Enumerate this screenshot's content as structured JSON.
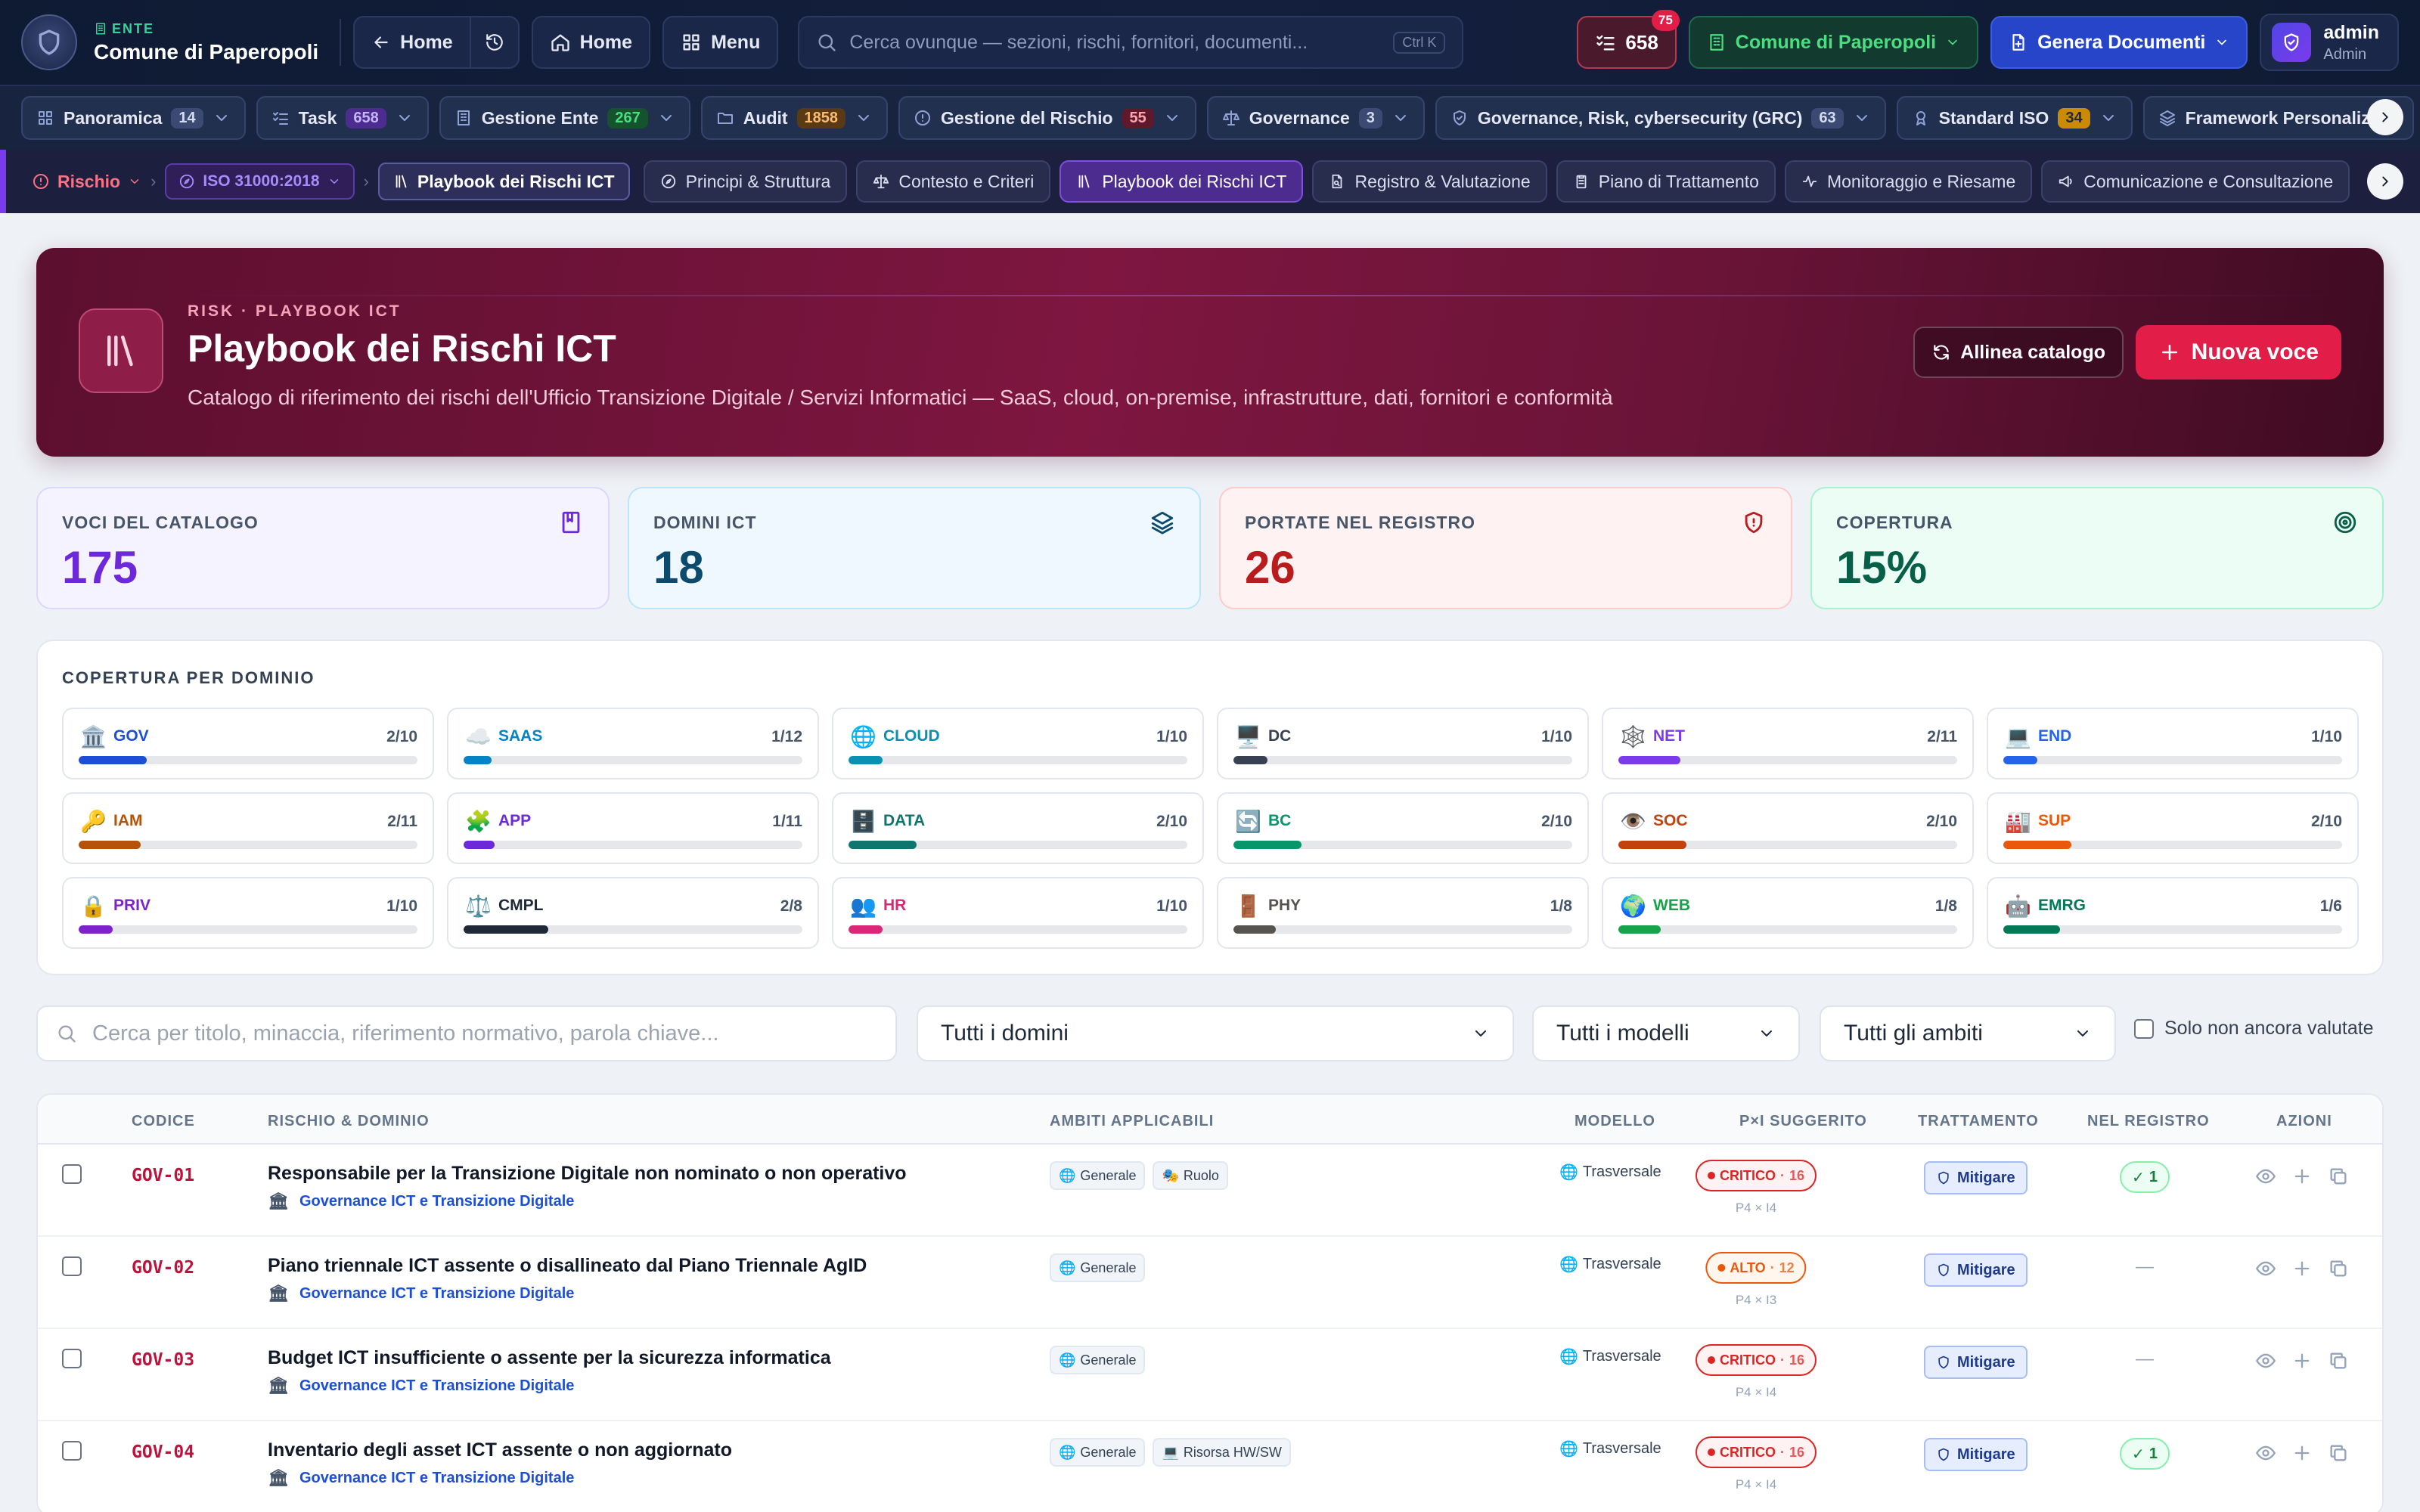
{
  "topbar": {
    "ente_label": "ENTE",
    "ente_name": "Comune di Paperopoli",
    "back_home": "Home",
    "home": "Home",
    "menu": "Menu",
    "search_placeholder": "Cerca ovunque — sezioni, rischi, fornitori, documenti...",
    "search_kbd": "Ctrl K",
    "tasks_count": "658",
    "tasks_badge": "75",
    "org_name": "Comune di Paperopoli",
    "generate_docs": "Genera Documenti",
    "user_name": "admin",
    "user_role": "Admin"
  },
  "navbar": {
    "items": [
      {
        "label": "Panoramica",
        "count": "14",
        "icon": "grid-icon",
        "count_bg": "#3a4a72",
        "count_fg": "#d6dcf0"
      },
      {
        "label": "Task",
        "count": "658",
        "icon": "checklist-icon",
        "count_bg": "#4c2d8f",
        "count_fg": "#c4b5fd"
      },
      {
        "label": "Gestione Ente",
        "count": "267",
        "icon": "building-icon",
        "count_bg": "#14532d",
        "count_fg": "#4ade80"
      },
      {
        "label": "Audit",
        "count": "1858",
        "icon": "folder-icon",
        "count_bg": "#5a3a14",
        "count_fg": "#fdba74"
      },
      {
        "label": "Gestione del Rischio",
        "count": "55",
        "icon": "alert-icon",
        "count_bg": "#5e1a2c",
        "count_fg": "#fda4af"
      },
      {
        "label": "Governance",
        "count": "3",
        "icon": "scale-icon",
        "count_bg": "#3a4a72",
        "count_fg": "#d6dcf0"
      },
      {
        "label": "Governance, Risk, cybersecurity (GRC)",
        "count": "63",
        "icon": "shield-check-icon",
        "count_bg": "#3a4a72",
        "count_fg": "#d6dcf0"
      },
      {
        "label": "Standard ISO",
        "count": "34",
        "icon": "award-icon",
        "count_bg": "#ca8a04",
        "count_fg": "#1f2937"
      },
      {
        "label": "Framework Personalizzati",
        "count": "",
        "icon": "layers-icon",
        "count_bg": "",
        "count_fg": ""
      }
    ]
  },
  "subnav": {
    "crumb_root": "Rischio",
    "crumb_std": "ISO 31000:2018",
    "crumb_page": "Playbook dei Rischi ICT",
    "tabs": [
      {
        "label": "Principi & Struttura",
        "icon": "compass-icon"
      },
      {
        "label": "Contesto e Criteri",
        "icon": "scale-icon"
      },
      {
        "label": "Playbook dei Rischi ICT",
        "icon": "library-icon"
      },
      {
        "label": "Registro & Valutazione",
        "icon": "file-search-icon"
      },
      {
        "label": "Piano di Trattamento",
        "icon": "clipboard-icon"
      },
      {
        "label": "Monitoraggio e Riesame",
        "icon": "activity-icon"
      },
      {
        "label": "Comunicazione e Consultazione",
        "icon": "megaphone-icon"
      }
    ]
  },
  "hero": {
    "kicker": "RISK · PLAYBOOK ICT",
    "title": "Playbook dei Rischi ICT",
    "subtitle": "Catalogo di riferimento dei rischi dell'Ufficio Transizione Digitale / Servizi Informatici — SaaS, cloud, on-premise, infrastrutture, dati, fornitori e conformità",
    "align_button": "Allinea catalogo",
    "new_button": "Nuova voce"
  },
  "stats": [
    {
      "label": "VOCI DEL CATALOGO",
      "value": "175",
      "color": "#6d28d9",
      "bg": "#f5f3ff",
      "border": "#ddd6fe",
      "icon": "book-icon"
    },
    {
      "label": "DOMINI ICT",
      "value": "18",
      "color": "#0c4a6e",
      "bg": "#eff8ff",
      "border": "#bae6fd",
      "icon": "layers-icon"
    },
    {
      "label": "PORTATE NEL REGISTRO",
      "value": "26",
      "color": "#b91c1c",
      "bg": "#fef2f2",
      "border": "#fecaca",
      "icon": "shield-alert-icon"
    },
    {
      "label": "COPERTURA",
      "value": "15%",
      "color": "#065f46",
      "bg": "#ecfdf5",
      "border": "#a7f3d0",
      "icon": "target-icon"
    }
  ],
  "coverage": {
    "title": "COPERTURA PER DOMINIO",
    "domains": [
      {
        "emoji": "🏛️",
        "code": "GOV",
        "value": "2/10",
        "fraction": 0.2,
        "color": "#1d4ed8"
      },
      {
        "emoji": "☁️",
        "code": "SAAS",
        "value": "1/12",
        "fraction": 0.083,
        "color": "#0284c7"
      },
      {
        "emoji": "🌐",
        "code": "CLOUD",
        "value": "1/10",
        "fraction": 0.1,
        "color": "#0891b2"
      },
      {
        "emoji": "🖥️",
        "code": "DC",
        "value": "1/10",
        "fraction": 0.1,
        "color": "#374151"
      },
      {
        "emoji": "🕸️",
        "code": "NET",
        "value": "2/11",
        "fraction": 0.182,
        "color": "#7c3aed"
      },
      {
        "emoji": "💻",
        "code": "END",
        "value": "1/10",
        "fraction": 0.1,
        "color": "#2563eb"
      },
      {
        "emoji": "🔑",
        "code": "IAM",
        "value": "2/11",
        "fraction": 0.182,
        "color": "#b45309"
      },
      {
        "emoji": "🧩",
        "code": "APP",
        "value": "1/11",
        "fraction": 0.091,
        "color": "#6d28d9"
      },
      {
        "emoji": "🗄️",
        "code": "DATA",
        "value": "2/10",
        "fraction": 0.2,
        "color": "#0f766e"
      },
      {
        "emoji": "🔄",
        "code": "BC",
        "value": "2/10",
        "fraction": 0.2,
        "color": "#059669"
      },
      {
        "emoji": "👁️",
        "code": "SOC",
        "value": "2/10",
        "fraction": 0.2,
        "color": "#c2410c"
      },
      {
        "emoji": "🏭",
        "code": "SUP",
        "value": "2/10",
        "fraction": 0.2,
        "color": "#ea580c"
      },
      {
        "emoji": "🔒",
        "code": "PRIV",
        "value": "1/10",
        "fraction": 0.1,
        "color": "#7e22ce"
      },
      {
        "emoji": "⚖️",
        "code": "CMPL",
        "value": "2/8",
        "fraction": 0.25,
        "color": "#1f2937"
      },
      {
        "emoji": "👥",
        "code": "HR",
        "value": "1/10",
        "fraction": 0.1,
        "color": "#db2777"
      },
      {
        "emoji": "🚪",
        "code": "PHY",
        "value": "1/8",
        "fraction": 0.125,
        "color": "#57534e"
      },
      {
        "emoji": "🌍",
        "code": "WEB",
        "value": "1/8",
        "fraction": 0.125,
        "color": "#16a34a"
      },
      {
        "emoji": "🤖",
        "code": "EMRG",
        "value": "1/6",
        "fraction": 0.167,
        "color": "#047857"
      }
    ]
  },
  "filters": {
    "search_placeholder": "Cerca per titolo, minaccia, riferimento normativo, parola chiave...",
    "domains": "Tutti i domini",
    "models": "Tutti i modelli",
    "scopes": "Tutti gli ambiti",
    "only_unassessed": "Solo non ancora valutate"
  },
  "table": {
    "headers": {
      "code": "CODICE",
      "risk": "RISCHIO & DOMINIO",
      "scopes": "AMBITI APPLICABILI",
      "model": "MODELLO",
      "pxi": "P×I SUGGERITO",
      "treatment": "TRATTAMENTO",
      "registry": "NEL REGISTRO",
      "actions": "AZIONI"
    },
    "rows": [
      {
        "code": "GOV-01",
        "title": "Responsabile per la Transizione Digitale non nominato o non operativo",
        "domain": "Governance ICT e Transizione Digitale",
        "tags": [
          {
            "icon": "🌐",
            "label": "Generale"
          },
          {
            "icon": "🎭",
            "label": "Ruolo"
          }
        ],
        "model": "Trasversale",
        "level": "CRITICO",
        "score": "16",
        "pi": "P4 × I4",
        "treatment": "Mitigare",
        "registry": "1"
      },
      {
        "code": "GOV-02",
        "title": "Piano triennale ICT assente o disallineato dal Piano Triennale AgID",
        "domain": "Governance ICT e Transizione Digitale",
        "tags": [
          {
            "icon": "🌐",
            "label": "Generale"
          }
        ],
        "model": "Trasversale",
        "level": "ALTO",
        "score": "12",
        "pi": "P4 × I3",
        "treatment": "Mitigare",
        "registry": ""
      },
      {
        "code": "GOV-03",
        "title": "Budget ICT insufficiente o assente per la sicurezza informatica",
        "domain": "Governance ICT e Transizione Digitale",
        "tags": [
          {
            "icon": "🌐",
            "label": "Generale"
          }
        ],
        "model": "Trasversale",
        "level": "CRITICO",
        "score": "16",
        "pi": "P4 × I4",
        "treatment": "Mitigare",
        "registry": ""
      },
      {
        "code": "GOV-04",
        "title": "Inventario degli asset ICT assente o non aggiornato",
        "domain": "Governance ICT e Transizione Digitale",
        "tags": [
          {
            "icon": "🌐",
            "label": "Generale"
          },
          {
            "icon": "💻",
            "label": "Risorsa HW/SW"
          }
        ],
        "model": "Trasversale",
        "level": "CRITICO",
        "score": "16",
        "pi": "P4 × I4",
        "treatment": "Mitigare",
        "registry": "1"
      }
    ]
  },
  "colors": {
    "critico": "#dc2626",
    "alto": "#ea580c",
    "accent": "#e11d48"
  }
}
